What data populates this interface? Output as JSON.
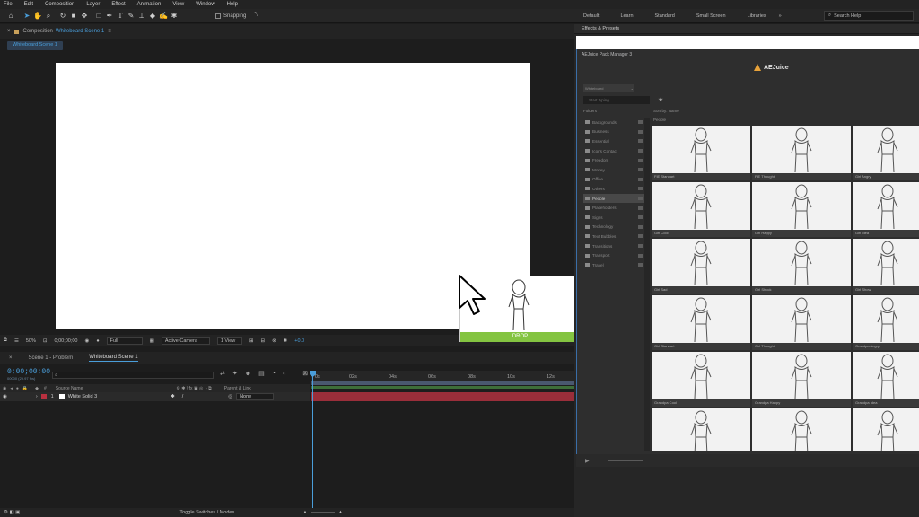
{
  "menu": [
    "File",
    "Edit",
    "Composition",
    "Layer",
    "Effect",
    "Animation",
    "View",
    "Window",
    "Help"
  ],
  "toolbar": {
    "snapping_label": "Snapping"
  },
  "workspaces": [
    "Default",
    "Learn",
    "Standard",
    "Small Screen",
    "Libraries"
  ],
  "search_help": {
    "placeholder": "Search Help"
  },
  "composition": {
    "panel_prefix": "Composition",
    "panel_name": "Whiteboard Scene 1",
    "subtab": "Whiteboard Scene 1",
    "zoom": "50%",
    "time": "0;00;00;00",
    "resolution": "Full",
    "camera": "Active Camera",
    "view": "1 View",
    "exposure": "+0.0"
  },
  "drop": {
    "label": "DROP"
  },
  "timeline": {
    "tabs": [
      "Scene 1 - Problem",
      "Whiteboard Scene 1"
    ],
    "timecode": "0;00;00;00",
    "timecode_sub": "00000 (29.97 fps)",
    "columns": {
      "source": "Source Name",
      "parent": "Parent & Link"
    },
    "layer": {
      "index": "1",
      "name": "White Solid 3",
      "parent": "None"
    },
    "ruler": [
      "0s",
      "02s",
      "04s",
      "06s",
      "08s",
      "10s",
      "12s"
    ],
    "toggle_label": "Toggle Switches / Modes"
  },
  "effects_panel": {
    "title": "Effects & Presets"
  },
  "pack_manager": {
    "title": "AEJuice Pack Manager 3",
    "logo": "AEJuice",
    "dropdown": "Whiteboard",
    "search_placeholder": "Start typing...",
    "folders_header": "Folders",
    "sort_label": "Sort by: Name",
    "section": "People",
    "folders": [
      {
        "name": "Backgrounds",
        "active": false
      },
      {
        "name": "Business",
        "active": false
      },
      {
        "name": "Essential",
        "active": false
      },
      {
        "name": "Icons Contact",
        "active": false
      },
      {
        "name": "Freedom",
        "active": false
      },
      {
        "name": "Money",
        "active": false
      },
      {
        "name": "Office",
        "active": false
      },
      {
        "name": "Others",
        "active": false
      },
      {
        "name": "People",
        "active": true
      },
      {
        "name": "Placeholders",
        "active": false
      },
      {
        "name": "Signs",
        "active": false
      },
      {
        "name": "Technology",
        "active": false
      },
      {
        "name": "Text Bubbles",
        "active": false
      },
      {
        "name": "Transitions",
        "active": false
      },
      {
        "name": "Transport",
        "active": false
      },
      {
        "name": "Travel",
        "active": false
      }
    ],
    "thumbnails": [
      "FIE Standart",
      "FIE Thought",
      "Girl Angry",
      "Girl Cool",
      "Girl Happy",
      "Girl Idea",
      "Girl Sad",
      "Girl Shock",
      "Girl Show",
      "Girl Standart",
      "Girl Thought",
      "Grandpa Angry",
      "Grandpa Cool",
      "Grandpa Happy",
      "Grandpa Idea",
      "",
      "",
      ""
    ]
  }
}
